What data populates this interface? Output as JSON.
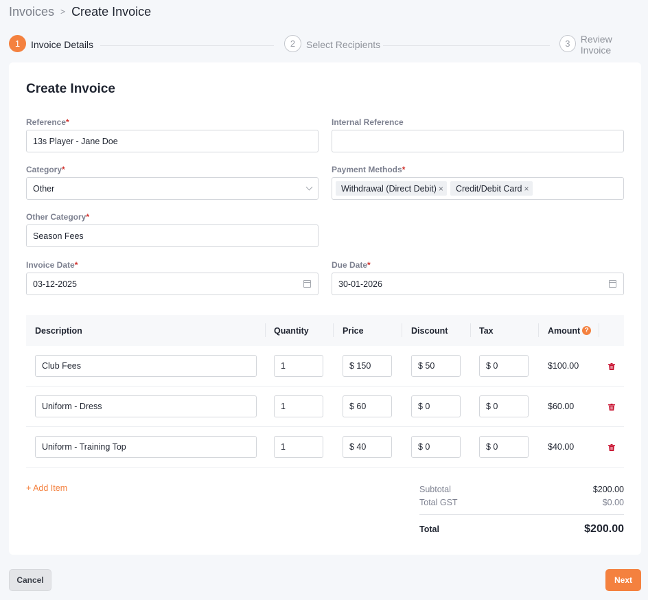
{
  "breadcrumb": {
    "parent": "Invoices",
    "separator": ">",
    "current": "Create Invoice"
  },
  "stepper": {
    "steps": [
      {
        "number": "1",
        "label": "Invoice Details"
      },
      {
        "number": "2",
        "label": "Select Recipients"
      },
      {
        "number": "3",
        "label": "Review Invoice"
      }
    ],
    "active": "1"
  },
  "form": {
    "title": "Create Invoice",
    "reference": {
      "label": "Reference",
      "required": "*",
      "value": "13s Player - Jane Doe"
    },
    "internal_reference": {
      "label": "Internal Reference",
      "value": ""
    },
    "category": {
      "label": "Category",
      "required": "*",
      "value": "Other"
    },
    "payment_methods": {
      "label": "Payment Methods",
      "required": "*",
      "chips": [
        "Withdrawal (Direct Debit)",
        "Credit/Debit Card"
      ],
      "remove_glyph": "×"
    },
    "other_category": {
      "label": "Other Category",
      "required": "*",
      "value": "Season Fees"
    },
    "invoice_date": {
      "label": "Invoice Date",
      "required": "*",
      "value": "03-12-2025"
    },
    "due_date": {
      "label": "Due Date",
      "required": "*",
      "value": "30-01-2026"
    }
  },
  "table": {
    "headers": {
      "description": "Description",
      "quantity": "Quantity",
      "price": "Price",
      "discount": "Discount",
      "tax": "Tax",
      "amount": "Amount",
      "help": "?"
    },
    "rows": [
      {
        "description": "Club Fees",
        "quantity": "1",
        "price": "$ 150",
        "discount": "$ 50",
        "tax": "$ 0",
        "amount": "$100.00"
      },
      {
        "description": "Uniform - Dress",
        "quantity": "1",
        "price": "$ 60",
        "discount": "$ 0",
        "tax": "$ 0",
        "amount": "$60.00"
      },
      {
        "description": "Uniform - Training Top",
        "quantity": "1",
        "price": "$ 40",
        "discount": "$ 0",
        "tax": "$ 0",
        "amount": "$40.00"
      }
    ]
  },
  "add_item": "+ Add Item",
  "totals": {
    "subtotal_label": "Subtotal",
    "subtotal": "$200.00",
    "gst_label": "Total GST",
    "gst": "$0.00",
    "total_label": "Total",
    "total": "$200.00"
  },
  "buttons": {
    "cancel": "Cancel",
    "next": "Next"
  },
  "colors": {
    "accent": "#f4813f",
    "required": "#d0312d",
    "delete": "#c8102e"
  }
}
